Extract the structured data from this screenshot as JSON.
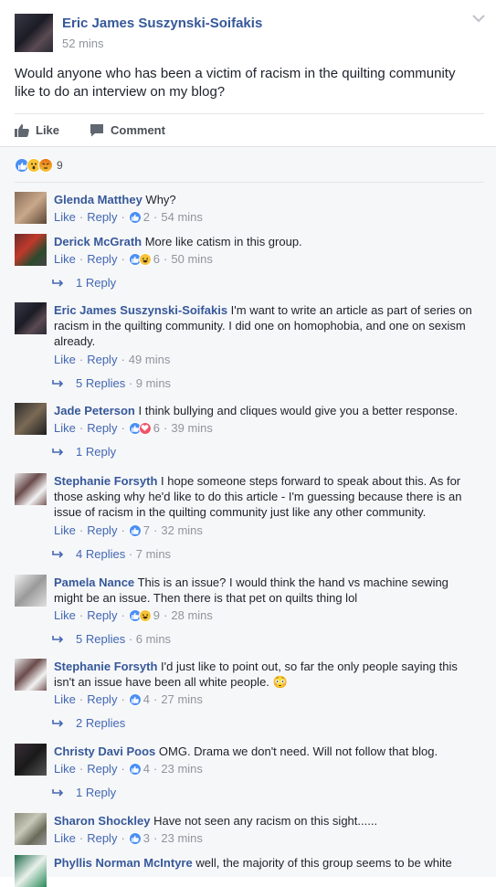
{
  "post": {
    "author": "Eric James Suszynski-Soifakis",
    "time": "52 mins",
    "text": "Would anyone who has been a victim of racism in the quilting community like to do an interview on my blog?",
    "like_label": "Like",
    "comment_label": "Comment",
    "reactions": [
      "like",
      "wow",
      "angry"
    ],
    "reaction_count": "9"
  },
  "comments": [
    {
      "name": "Glenda Matthey",
      "text": "Why?",
      "like": "Like",
      "reply": "Reply",
      "reactions": [
        "like"
      ],
      "count": "2",
      "time": "54 mins",
      "replies": null
    },
    {
      "name": "Derick McGrath",
      "text": "More like catism in this group.",
      "like": "Like",
      "reply": "Reply",
      "reactions": [
        "like",
        "haha"
      ],
      "count": "6",
      "time": "50 mins",
      "replies": {
        "label": "1 Reply",
        "time": ""
      }
    },
    {
      "name": "Eric James Suszynski-Soifakis",
      "text": "I'm want to write an article as part of series on racism in the quilting community. I did one on homophobia, and one on sexism already.",
      "like": "Like",
      "reply": "Reply",
      "reactions": [],
      "count": "",
      "time": "49 mins",
      "replies": {
        "label": "5 Replies",
        "time": "9 mins"
      }
    },
    {
      "name": "Jade Peterson",
      "text": "I think bullying and cliques would give you a better response.",
      "like": "Like",
      "reply": "Reply",
      "reactions": [
        "like",
        "love"
      ],
      "count": "6",
      "time": "39 mins",
      "replies": {
        "label": "1 Reply",
        "time": ""
      }
    },
    {
      "name": "Stephanie Forsyth",
      "text": "I hope someone steps forward to speak about this. As for those asking why he'd like to do this article - I'm guessing because there is an issue of racism in the quilting community just like any other community.",
      "like": "Like",
      "reply": "Reply",
      "reactions": [
        "like"
      ],
      "count": "7",
      "time": "32 mins",
      "replies": {
        "label": "4 Replies",
        "time": "7 mins"
      }
    },
    {
      "name": "Pamela Nance",
      "text": "This is an issue? I would think the hand vs machine sewing might be an issue. Then there is that pet on quilts thing lol",
      "like": "Like",
      "reply": "Reply",
      "reactions": [
        "like",
        "haha"
      ],
      "count": "9",
      "time": "28 mins",
      "replies": {
        "label": "5 Replies",
        "time": "6 mins"
      }
    },
    {
      "name": "Stephanie Forsyth",
      "text": "I'd just like to point out, so far the only people saying this isn't an issue have been all white people. 😳",
      "like": "Like",
      "reply": "Reply",
      "reactions": [
        "like"
      ],
      "count": "4",
      "time": "27 mins",
      "replies": {
        "label": "2 Replies",
        "time": ""
      }
    },
    {
      "name": "Christy Davi Poos",
      "text": "OMG. Drama we don't need. Will not follow that blog.",
      "like": "Like",
      "reply": "Reply",
      "reactions": [
        "like"
      ],
      "count": "4",
      "time": "23 mins",
      "replies": {
        "label": "1 Reply",
        "time": ""
      }
    },
    {
      "name": "Sharon Shockley",
      "text": "Have not seen any racism on this sight......",
      "like": "Like",
      "reply": "Reply",
      "reactions": [
        "like"
      ],
      "count": "3",
      "time": "23 mins",
      "replies": null
    },
    {
      "name": "Phyllis Norman McIntyre",
      "text": "well, the majority of this group seems to be white",
      "like": "",
      "reply": "",
      "reactions": [],
      "count": "",
      "time": "",
      "replies": null
    }
  ],
  "colors": {
    "link": "#365899",
    "action_link": "#4267b2",
    "meta": "#90949c",
    "like_reaction": "#4a8ff5",
    "love_reaction": "#f25268"
  }
}
